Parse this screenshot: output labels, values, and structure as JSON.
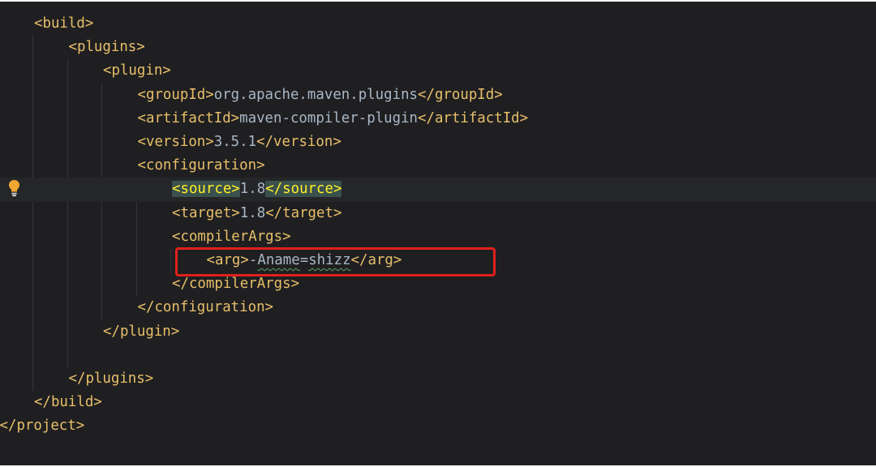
{
  "editor": {
    "language": "xml",
    "lines": [
      {
        "indent": 1,
        "parts": [
          {
            "kind": "tag",
            "text": "<build>"
          }
        ]
      },
      {
        "indent": 2,
        "parts": [
          {
            "kind": "tag",
            "text": "<plugins>"
          }
        ]
      },
      {
        "indent": 3,
        "parts": [
          {
            "kind": "tag",
            "text": "<plugin>"
          }
        ]
      },
      {
        "indent": 4,
        "parts": [
          {
            "kind": "tag",
            "text": "<groupId>"
          },
          {
            "kind": "text",
            "text": "org.apache.maven.plugins"
          },
          {
            "kind": "tag",
            "text": "</groupId>"
          }
        ]
      },
      {
        "indent": 4,
        "parts": [
          {
            "kind": "tag",
            "text": "<artifactId>"
          },
          {
            "kind": "text",
            "text": "maven-compiler-plugin"
          },
          {
            "kind": "tag",
            "text": "</artifactId>"
          }
        ]
      },
      {
        "indent": 4,
        "parts": [
          {
            "kind": "tag",
            "text": "<version>"
          },
          {
            "kind": "text",
            "text": "3.5.1"
          },
          {
            "kind": "tag",
            "text": "</version>"
          }
        ]
      },
      {
        "indent": 4,
        "parts": [
          {
            "kind": "tag",
            "text": "<configuration>"
          }
        ]
      },
      {
        "indent": 5,
        "caret_line": true,
        "gutter_icon": "lightbulb-icon",
        "parts": [
          {
            "kind": "tag",
            "text": "<source>",
            "matched": true
          },
          {
            "kind": "text",
            "text": "1.8"
          },
          {
            "kind": "tag",
            "text": "</source>",
            "matched": true
          }
        ]
      },
      {
        "indent": 5,
        "parts": [
          {
            "kind": "tag",
            "text": "<target>"
          },
          {
            "kind": "text",
            "text": "1.8"
          },
          {
            "kind": "tag",
            "text": "</target>"
          }
        ]
      },
      {
        "indent": 5,
        "parts": [
          {
            "kind": "tag",
            "text": "<compilerArgs>"
          }
        ]
      },
      {
        "indent": 6,
        "highlighted": true,
        "parts": [
          {
            "kind": "tag",
            "text": "<arg>"
          },
          {
            "kind": "text",
            "text": "-"
          },
          {
            "kind": "text",
            "text": "Aname",
            "typo": true
          },
          {
            "kind": "text",
            "text": "="
          },
          {
            "kind": "text",
            "text": "shizz",
            "typo": true
          },
          {
            "kind": "tag",
            "text": "</arg>"
          }
        ]
      },
      {
        "indent": 5,
        "parts": [
          {
            "kind": "tag",
            "text": "</compilerArgs>"
          }
        ]
      },
      {
        "indent": 4,
        "parts": [
          {
            "kind": "tag",
            "text": "</configuration>"
          }
        ]
      },
      {
        "indent": 3,
        "parts": [
          {
            "kind": "tag",
            "text": "</plugin>"
          }
        ]
      },
      {
        "indent": 0,
        "parts": []
      },
      {
        "indent": 2,
        "parts": [
          {
            "kind": "tag",
            "text": "</plugins>"
          }
        ]
      },
      {
        "indent": 1,
        "parts": [
          {
            "kind": "tag",
            "text": "</build>"
          }
        ]
      },
      {
        "indent": 0,
        "parts": [
          {
            "kind": "tag",
            "text": "</project>"
          }
        ]
      }
    ]
  },
  "colors": {
    "background": "#1f1f21",
    "tag": "#e8bf6a",
    "text": "#a9b7c6",
    "matched_tag": "#ffef28",
    "highlight_box": "#e0201c",
    "typo_underline": "#5fa35f"
  }
}
